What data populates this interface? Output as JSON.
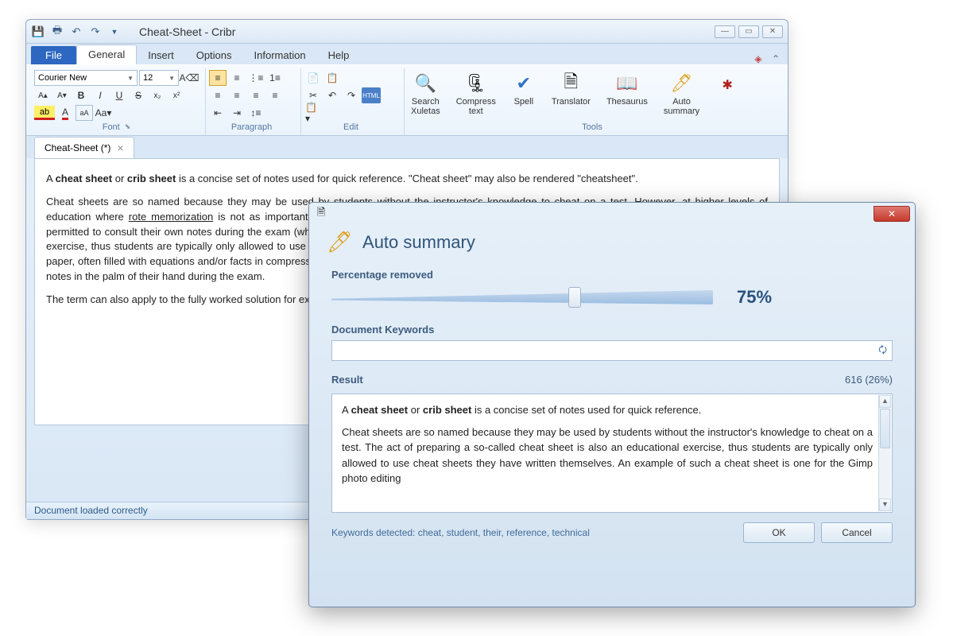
{
  "window": {
    "title": "Cheat-Sheet - Cribr"
  },
  "menu": {
    "file": "File",
    "tabs": [
      "General",
      "Insert",
      "Options",
      "Information",
      "Help"
    ],
    "active": 0
  },
  "ribbon": {
    "font": {
      "name": "Font",
      "family": "Courier New",
      "size": "12"
    },
    "paragraph": {
      "name": "Paragraph"
    },
    "edit": {
      "name": "Edit"
    },
    "tools": {
      "name": "Tools",
      "items": [
        {
          "label": "Search\nXuletas",
          "icon": "🔍"
        },
        {
          "label": "Compress\ntext",
          "icon": "🗜"
        },
        {
          "label": "Spell",
          "icon": "✔"
        },
        {
          "label": "Translator",
          "icon": "🗎"
        },
        {
          "label": "Thesaurus",
          "icon": "📖"
        },
        {
          "label": "Auto\nsummary",
          "icon": "🖊"
        }
      ],
      "bug_icon": "✱"
    }
  },
  "doc_tab": {
    "label": "Cheat-Sheet (*)"
  },
  "document": {
    "p1_pre": "A ",
    "p1_b1": "cheat sheet",
    "p1_mid": " or ",
    "p1_b2": "crib sheet",
    "p1_post": " is a concise set of notes used for quick reference. \"Cheat sheet\" may also be rendered \"cheatsheet\".",
    "p2_a": "Cheat sheets are so named because they may be used by students without the instructor's knowledge to ",
    "p2_u1": "cheat",
    "p2_b": " on a ",
    "p2_u2": "test",
    "p2_c": ". However, at higher levels of education where ",
    "p2_u3": "rote memorization",
    "p2_d": " is not as important as in basic education, or in open-book studies, high school or undergraduate students may be permitted to consult their own notes during the exam (which is not considered cheating). The act of preparing a so-called cheat sheet is also an educational exercise, thus students are typically only allowed to use cheat sheets they have written themselves. A cheat sheet is most often named a physical piece of paper, often filled with equations and/or facts in compressed writing. Modern students often print cheat sheets in extremely small font, fitting an entire page of notes in the palm of their hand during the exam.",
    "p3": "The term can also apply to the fully worked solution for exams or work sheets normally handed out to university staff to ease marking."
  },
  "status": "Document loaded correctly",
  "dialog": {
    "title": "Auto summary",
    "percentage_label": "Percentage removed",
    "percentage_value": "75%",
    "percentage_pos": 62,
    "keywords_label": "Document Keywords",
    "keywords_value": "",
    "result_label": "Result",
    "result_count": "616 (26%)",
    "result": {
      "p1_pre": "A ",
      "p1_b1": "cheat sheet",
      "p1_mid": " or ",
      "p1_b2": "crib sheet",
      "p1_post": " is a concise set of notes used for quick reference.",
      "p2_a": "Cheat sheets are so named because they may be used by students without the instructor's knowledge to ",
      "p2_u1": "cheat",
      "p2_b": " on a ",
      "p2_u2": "test",
      "p2_c": ". The act of preparing a so-called cheat sheet is also an educational exercise, thus students are typically only allowed to use cheat sheets they have written themselves. An example of such a cheat sheet is one for the ",
      "p2_u3": "Gimp",
      "p2_d": " photo editing"
    },
    "detected_label": "Keywords detected: ",
    "detected_value": "cheat, student, their, reference, technical",
    "ok": "OK",
    "cancel": "Cancel"
  }
}
